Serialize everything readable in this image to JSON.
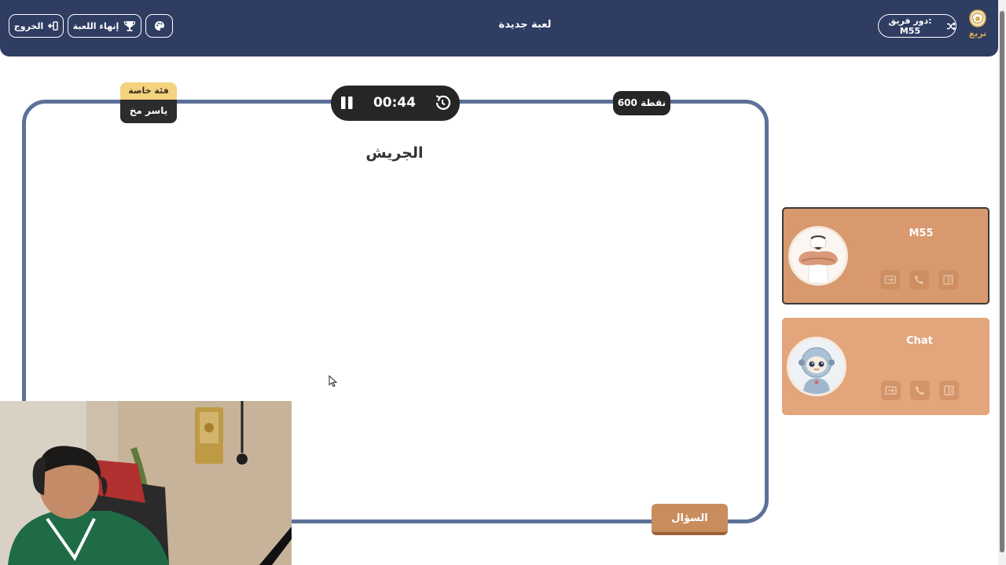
{
  "header": {
    "exit_label": "الخروج",
    "end_game_label": "إنهاء اللعبة",
    "title": "لعبة جديدة",
    "turn_label": "دور فريق: M55",
    "logo_text": "تريع"
  },
  "board": {
    "category_label": "فئة خاصة",
    "category_name": "ياسر مخ",
    "timer": "00:44",
    "points": "600 نقطة",
    "answer": "الجريش",
    "question_button": "السؤال"
  },
  "teams": [
    {
      "name": "M55",
      "active": true,
      "avatar": "muscular-man-avatar"
    },
    {
      "name": "Chat",
      "active": false,
      "avatar": "robot-avatar"
    }
  ],
  "colors": {
    "header_bg": "#2f3d63",
    "board_border": "#5c7198",
    "team_card": "#d9996e",
    "category_badge": "#f4d37e",
    "question_button": "#c98c5d"
  }
}
